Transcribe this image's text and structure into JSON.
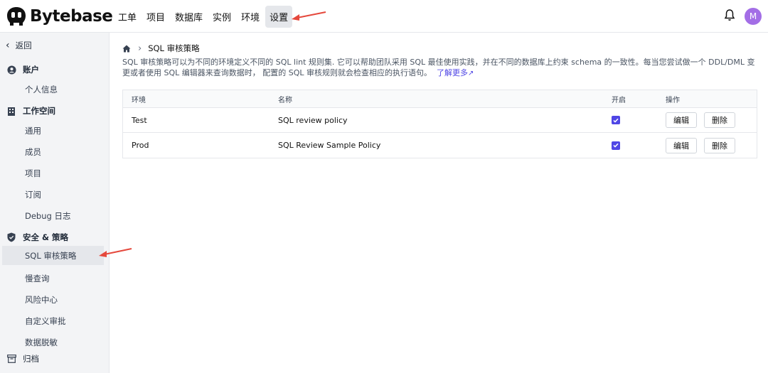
{
  "brand": {
    "name": "Bytebase"
  },
  "nav": {
    "items": [
      "工单",
      "项目",
      "数据库",
      "实例",
      "环境",
      "设置"
    ],
    "active_index": 5
  },
  "user": {
    "avatar_initial": "M"
  },
  "sidebar": {
    "back_label": "返回",
    "sections": [
      {
        "label": "账户",
        "icon": "user-circle-icon",
        "items": [
          "个人信息"
        ]
      },
      {
        "label": "工作空间",
        "icon": "building-icon",
        "items": [
          "通用",
          "成员",
          "项目",
          "订阅",
          "Debug 日志"
        ]
      },
      {
        "label": "安全 & 策略",
        "icon": "shield-icon",
        "items": [
          "SQL 审核策略",
          "慢查询",
          "风险中心",
          "自定义审批",
          "数据脱敏"
        ]
      }
    ],
    "active_item": "SQL 审核策略",
    "archive_label": "归档"
  },
  "breadcrumb": {
    "current": "SQL 审核策略"
  },
  "description": {
    "text": "SQL 审核策略可以为不同的环境定义不同的 SQL lint 规则集. 它可以帮助团队采用 SQL 最佳使用实践，并在不同的数据库上约束 schema 的一致性。每当您尝试做一个 DDL/DML 变更或者使用 SQL 编辑器来查询数据时， 配置的 SQL 审核规则就会检查相应的执行语句。",
    "link": "了解更多"
  },
  "table": {
    "headers": {
      "env": "环境",
      "name": "名称",
      "enabled": "开启",
      "actions": "操作"
    },
    "rows": [
      {
        "env": "Test",
        "name": "SQL review policy",
        "enabled": true,
        "edit": "编辑",
        "delete": "删除"
      },
      {
        "env": "Prod",
        "name": "SQL Review Sample Policy",
        "enabled": true,
        "edit": "编辑",
        "delete": "删除"
      }
    ]
  },
  "colors": {
    "accent": "#4f46e5",
    "avatar": "#a36ee6",
    "annotation_arrow": "#e5483c"
  }
}
